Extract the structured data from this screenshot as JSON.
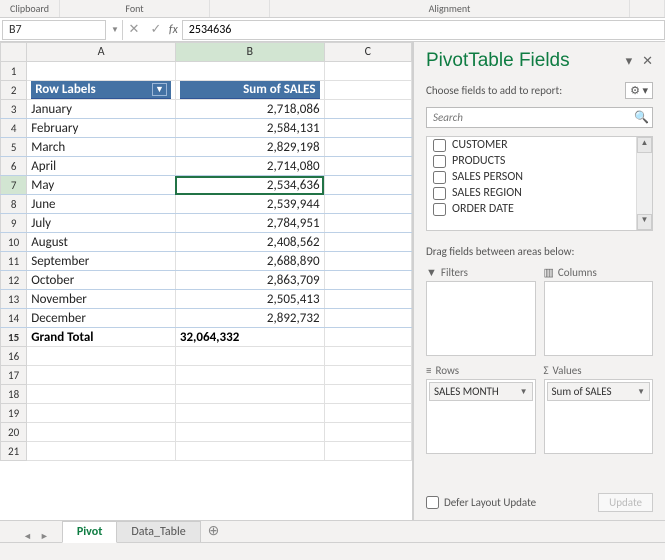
{
  "ribbon": {
    "g1": "Clipboard",
    "g2": "Font",
    "g4": "Alignment"
  },
  "namebox": "B7",
  "formula": "2534636",
  "headers": {
    "A": "A",
    "B": "B",
    "C": "C"
  },
  "pivot": {
    "rowLabelHeader": "Row Labels",
    "valueHeader": "Sum of SALES",
    "rows": [
      {
        "label": "January",
        "value": "2,718,086"
      },
      {
        "label": "February",
        "value": "2,584,131"
      },
      {
        "label": "March",
        "value": "2,829,198"
      },
      {
        "label": "April",
        "value": "2,714,080"
      },
      {
        "label": "May",
        "value": "2,534,636"
      },
      {
        "label": "June",
        "value": "2,539,944"
      },
      {
        "label": "July",
        "value": "2,784,951"
      },
      {
        "label": "August",
        "value": "2,408,562"
      },
      {
        "label": "September",
        "value": "2,688,890"
      },
      {
        "label": "October",
        "value": "2,863,709"
      },
      {
        "label": "November",
        "value": "2,505,413"
      },
      {
        "label": "December",
        "value": "2,892,732"
      }
    ],
    "totalLabel": "Grand Total",
    "totalValue": "32,064,332"
  },
  "pane": {
    "title": "PivotTable Fields",
    "chooseLabel": "Choose fields to add to report:",
    "searchPlaceholder": "Search",
    "fields": [
      "CUSTOMER",
      "PRODUCTS",
      "SALES PERSON",
      "SALES REGION",
      "ORDER DATE"
    ],
    "dragLabel": "Drag fields between areas below:",
    "filtersLabel": "Filters",
    "columnsLabel": "Columns",
    "rowsLabel": "Rows",
    "valuesLabel": "Values",
    "rowChip": "SALES MONTH",
    "valChip": "Sum of SALES",
    "deferLabel": "Defer Layout Update",
    "updateLabel": "Update"
  },
  "tabs": {
    "active": "Pivot",
    "other": "Data_Table"
  }
}
